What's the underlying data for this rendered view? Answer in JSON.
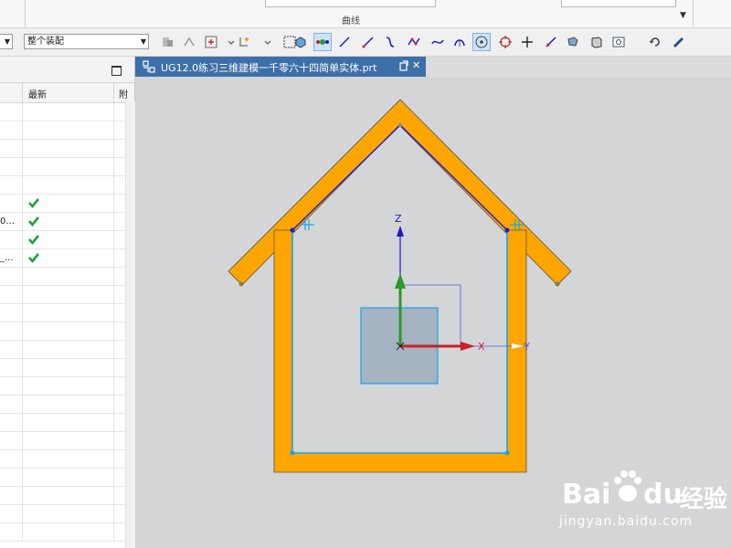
{
  "ribbon": {
    "group_label": "曲线",
    "collapse_glyph": "▼"
  },
  "toolbar": {
    "selection_scope": "整个装配",
    "icons": [
      "select-filter-icon",
      "snap-icon",
      "add-point-icon",
      "arrow-drop-icon",
      "select-box-icon",
      "chevron-down-icon",
      "render-style-icon",
      "cube-view-icon",
      "move-handles-icon",
      "line-icon",
      "line-alt-icon",
      "curve-icon",
      "spline-icon",
      "studio-spline-icon",
      "arc-icon",
      "circle-center-icon",
      "circle-quadrant-icon",
      "intersection-icon",
      "tangent-line-icon",
      "view-orient-icon",
      "layer-icon",
      "fit-view-icon",
      "refresh-icon",
      "brush-icon"
    ]
  },
  "nav": {
    "columns": [
      "最新",
      "附"
    ],
    "rows": [
      {
        "name": "",
        "latest": false
      },
      {
        "name": "",
        "latest": false
      },
      {
        "name": "",
        "latest": false
      },
      {
        "name": "",
        "latest": false
      },
      {
        "name": "",
        "latest": false
      },
      {
        "name": "",
        "latest": true
      },
      {
        "name": "0...",
        "latest": true
      },
      {
        "name": "",
        "latest": true
      },
      {
        "name": "_...",
        "latest": true
      },
      {
        "name": "",
        "latest": false
      },
      {
        "name": "",
        "latest": false
      },
      {
        "name": "",
        "latest": false
      },
      {
        "name": "",
        "latest": false
      },
      {
        "name": "",
        "latest": false
      },
      {
        "name": "",
        "latest": false
      },
      {
        "name": "",
        "latest": false
      },
      {
        "name": "",
        "latest": false
      },
      {
        "name": "",
        "latest": false
      },
      {
        "name": "",
        "latest": false
      },
      {
        "name": "",
        "latest": false
      },
      {
        "name": "",
        "latest": false
      },
      {
        "name": "",
        "latest": false
      },
      {
        "name": "",
        "latest": false
      },
      {
        "name": "",
        "latest": false
      }
    ]
  },
  "tab": {
    "title": "UG12.0练习三维建模一千零六十四简单实体.prt",
    "close_glyph": "✕"
  },
  "viewport": {
    "axis_labels": {
      "x": "X",
      "y": "Y",
      "z": "Z"
    },
    "colors": {
      "profile": "#ffa500",
      "sketch": "#1aa3e8",
      "x_axis": "#cc2020",
      "y_axis": "#2a9a2a",
      "z_axis": "#1a1ad0",
      "background": "#d3d5d7"
    }
  },
  "watermark": {
    "brand_left": "Bai",
    "brand_right": "du",
    "brand_cn": "经验",
    "url": "jingyan.baidu.com"
  }
}
